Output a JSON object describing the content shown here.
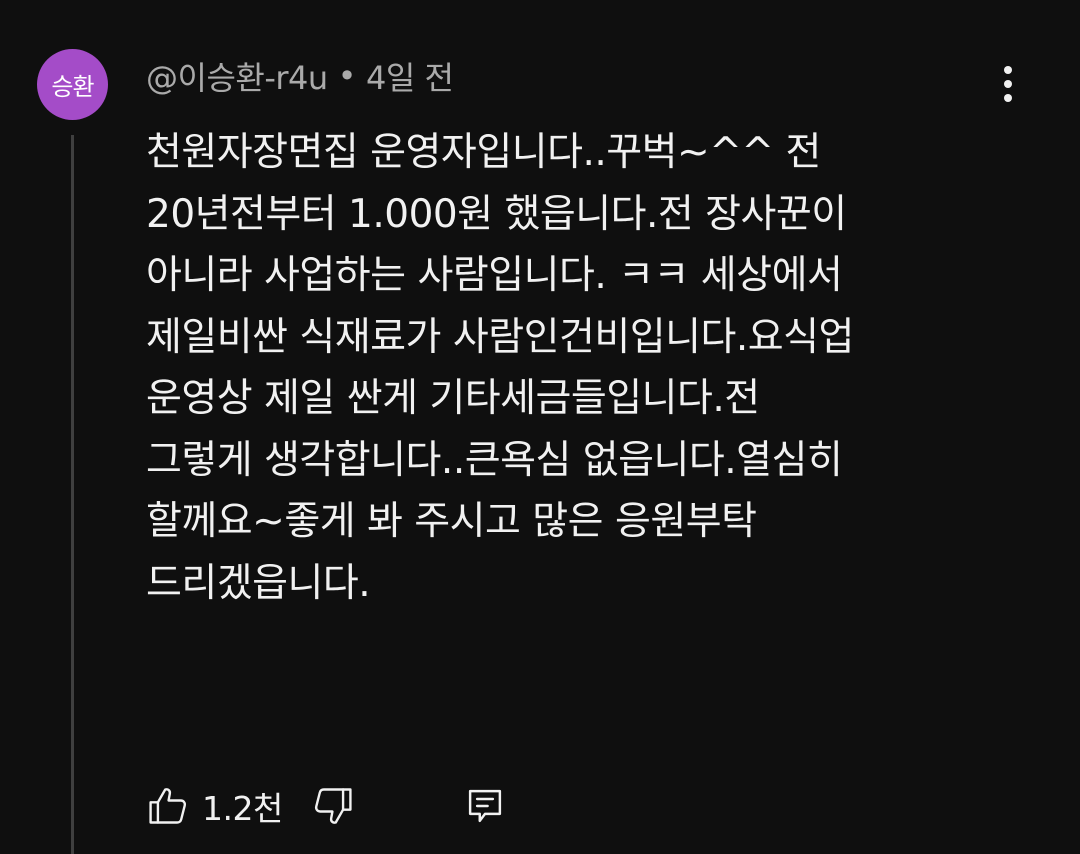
{
  "comment": {
    "avatar_text": "승환",
    "author": "@이승환-r4u",
    "separator": "•",
    "time": "4일 전",
    "text_lines": [
      "천원자장면집 운영자입니다..꾸벅~^^ 전",
      "20년전부터 1.000원 했읍니다.전 장사꾼이",
      "아니라 사업하는 사람입니다. ㅋㅋ 세상에서",
      "제일비싼 식재료가 사람인건비입니다.요식업",
      "운영상 제일 싼게 기타세금들입니다.전",
      "그렇게 생각합니다..큰욕심 없읍니다.열심히",
      "할께요~좋게 봐 주시고 많은 응원부탁",
      "드리겠읍니다."
    ],
    "like_count": "1.2천"
  },
  "icons": {
    "avatar": "avatar",
    "menu": "more-vert-icon",
    "like": "thumbs-up-icon",
    "dislike": "thumbs-down-icon",
    "reply": "reply-comment-icon"
  },
  "colors": {
    "background": "#0f0f0f",
    "avatar_bg": "#a44cc8",
    "text_primary": "#f1f1f1",
    "text_secondary": "#aaaaaa",
    "thread_line": "#3f3f3f"
  }
}
